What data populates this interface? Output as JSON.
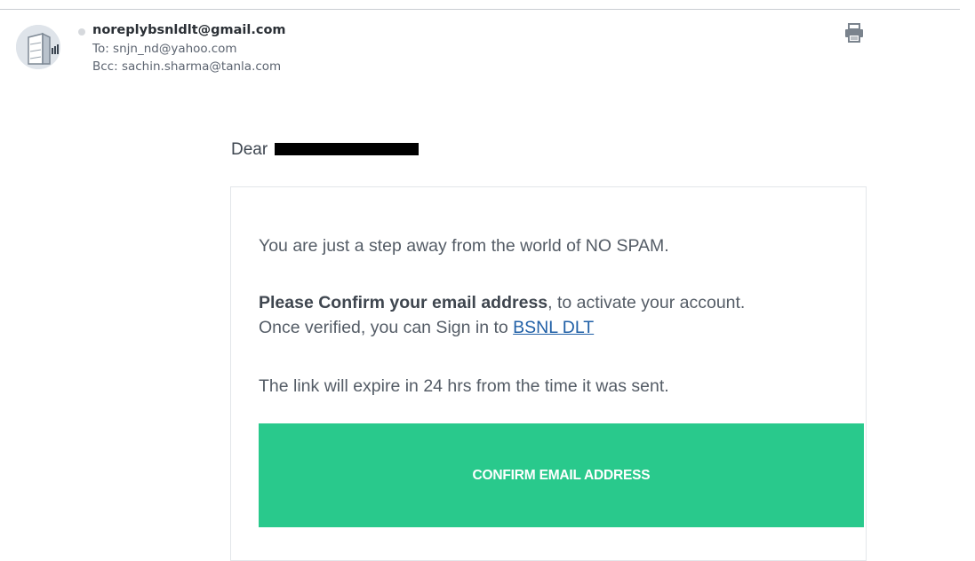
{
  "email": {
    "sender": "noreplybsnldlt@gmail.com",
    "to_line": "To: snjn_nd@yahoo.com",
    "bcc_line": "Bcc: sachin.sharma@tanla.com",
    "icons": {
      "avatar": "building-avatar-icon",
      "print": "printer-icon"
    }
  },
  "body": {
    "greeting": "Dear",
    "paragraph1": "You are just a step away from the world of NO SPAM.",
    "paragraph2_bold": "Please Confirm your email address",
    "paragraph2_rest": ", to activate your account.",
    "paragraph2_line2": "Once verified, you can Sign in to ",
    "link_text": "BSNL DLT",
    "paragraph3": "The link will expire in 24 hrs from the time it was sent.",
    "button_label": "CONFIRM EMAIL ADDRESS"
  },
  "colors": {
    "button": "#29c98c",
    "link": "#1f5fa6"
  }
}
